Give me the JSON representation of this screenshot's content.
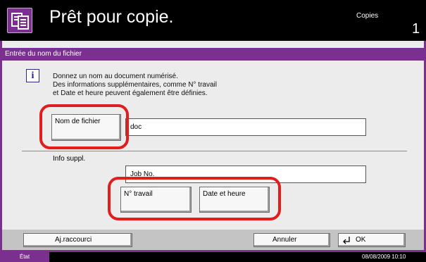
{
  "header": {
    "title": "Prêt pour copie.",
    "copies_label": "Copies",
    "copies_count": "1",
    "app_icon": "copy-document-icon"
  },
  "dialog": {
    "title": "Entrée du nom du fichier",
    "info_icon": "info-icon",
    "message_lines": [
      "Donnez un nom au document numérisé.",
      "Des informations supplémentaires, comme N° travail",
      "et Date et heure peuvent également être définies."
    ],
    "filename_button": "Nom de fichier",
    "filename_value": "doc",
    "info_label": "Info suppl.",
    "info_value": "Job No.",
    "job_button": "N° travail",
    "date_button": "Date et heure"
  },
  "bottom": {
    "shortcut_button": "Aj.raccourci",
    "cancel_button": "Annuler",
    "ok_button": "OK"
  },
  "status": {
    "label": "État",
    "datetime": "08/08/2009   10:10"
  },
  "colors": {
    "accent": "#7b2f8f",
    "highlight_ring": "#e11d1d"
  }
}
